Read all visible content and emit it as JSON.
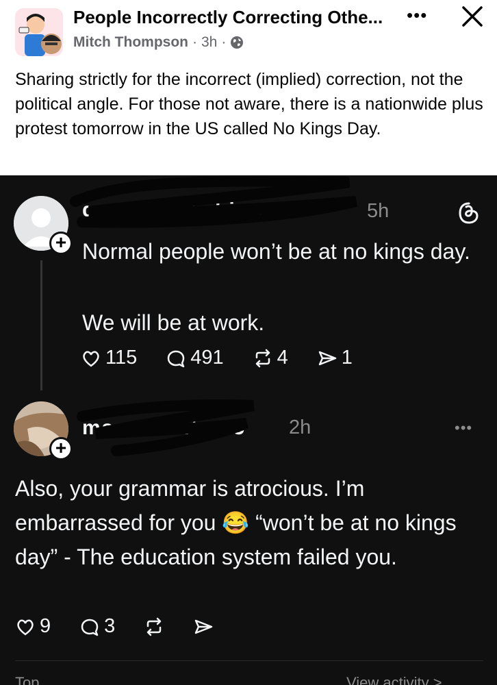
{
  "post_header": {
    "group_name": "People Incorrectly Correcting Othe...",
    "author": "Mitch Thompson",
    "separator": "·",
    "time": "3h",
    "more_label": "•••",
    "close_label": "✕"
  },
  "post_text": "Sharing strictly for the incorrect (implied) correction, not the political angle. For those not aware, there is a nationwide plus protest tomorrow in the US called No Kings Day.",
  "threads": {
    "reply1": {
      "username": "graceie...wshin...s",
      "time": "5h",
      "line1": "Normal people won’t be at no kings day.",
      "line2": "We will be at work.",
      "likes": "115",
      "comments": "491",
      "reposts": "4",
      "shares": "1"
    },
    "reply2": {
      "username": "mss...ni...t...05",
      "time": "2h",
      "text": "Also, your grammar is atrocious. I’m embarrassed for you 😂 “won’t be at no kings day” - The education system failed you.",
      "likes": "9",
      "comments": "3",
      "more_label": "•••"
    },
    "footer_left": "Top",
    "footer_right": "View activity >"
  },
  "colors": {
    "threads_bg": "#101010",
    "threads_text": "#f3f5f7",
    "muted": "#8c8c8c",
    "fb_text": "#050505",
    "fb_muted": "#65676b"
  }
}
